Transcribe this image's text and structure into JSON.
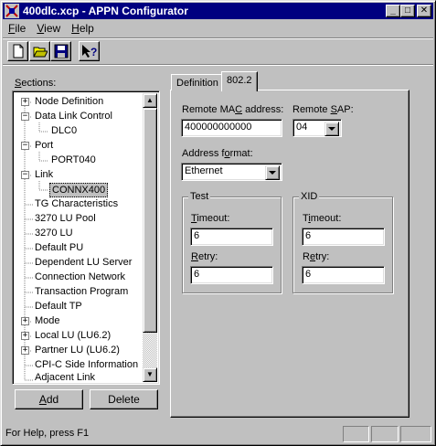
{
  "window": {
    "title": "400dlc.xcp - APPN Configurator",
    "minimize_glyph": "_",
    "maximize_glyph": "□",
    "close_glyph": "✕"
  },
  "menu": {
    "file": {
      "accel": "F",
      "rest": "ile"
    },
    "view": {
      "accel": "V",
      "rest": "iew"
    },
    "help": {
      "accel": "H",
      "rest": "elp"
    }
  },
  "toolbar": {
    "icons": [
      "new-file-icon",
      "open-folder-icon",
      "save-disk-icon",
      "context-help-icon"
    ],
    "help_glyph": "?"
  },
  "sections": {
    "label_accel": "S",
    "label_rest": "ections:",
    "items": [
      {
        "label": "Node Definition",
        "expander": "+"
      },
      {
        "label": "Data Link Control",
        "expander": "−"
      },
      {
        "label": "DLC0"
      },
      {
        "label": "Port",
        "expander": "−"
      },
      {
        "label": "PORT040"
      },
      {
        "label": "Link",
        "expander": "−"
      },
      {
        "label": "CONNX400"
      },
      {
        "label": "TG Characteristics"
      },
      {
        "label": "3270 LU Pool"
      },
      {
        "label": "3270 LU"
      },
      {
        "label": "Default PU"
      },
      {
        "label": "Dependent LU Server"
      },
      {
        "label": "Connection Network"
      },
      {
        "label": "Transaction Program"
      },
      {
        "label": "Default TP"
      },
      {
        "label": "Mode",
        "expander": "+"
      },
      {
        "label": "Local LU (LU6.2)",
        "expander": "+"
      },
      {
        "label": "Partner LU (LU6.2)",
        "expander": "+"
      },
      {
        "label": "CPI-C Side Information"
      },
      {
        "label": "Adjacent Link"
      }
    ],
    "add_accel": "A",
    "add_rest": "dd",
    "delete_label": "Delete"
  },
  "tabs": {
    "definition": "Definition",
    "active": "802.2"
  },
  "form": {
    "remote_mac_label_a": "Remote MA",
    "remote_mac_accel": "C",
    "remote_mac_label_b": " address:",
    "remote_mac_value": "400000000000",
    "remote_sap_label_a": "Remote ",
    "remote_sap_accel": "S",
    "remote_sap_label_b": "AP:",
    "remote_sap_value": "04",
    "address_format_label_a": "Address f",
    "address_format_accel": "o",
    "address_format_label_b": "rmat:",
    "address_format_value": "Ethernet",
    "test": {
      "title": "Test",
      "timeout_accel": "T",
      "timeout_rest": "imeout:",
      "timeout_value": "6",
      "retry_accel": "R",
      "retry_rest": "etry:",
      "retry_value": "6"
    },
    "xid": {
      "title": "XID",
      "timeout_a": "T",
      "timeout_accel": "i",
      "timeout_b": "meout:",
      "timeout_value": "6",
      "retry_a": "R",
      "retry_accel": "e",
      "retry_b": "try:",
      "retry_value": "6"
    }
  },
  "status_bar": {
    "text": "For Help, press F1"
  }
}
